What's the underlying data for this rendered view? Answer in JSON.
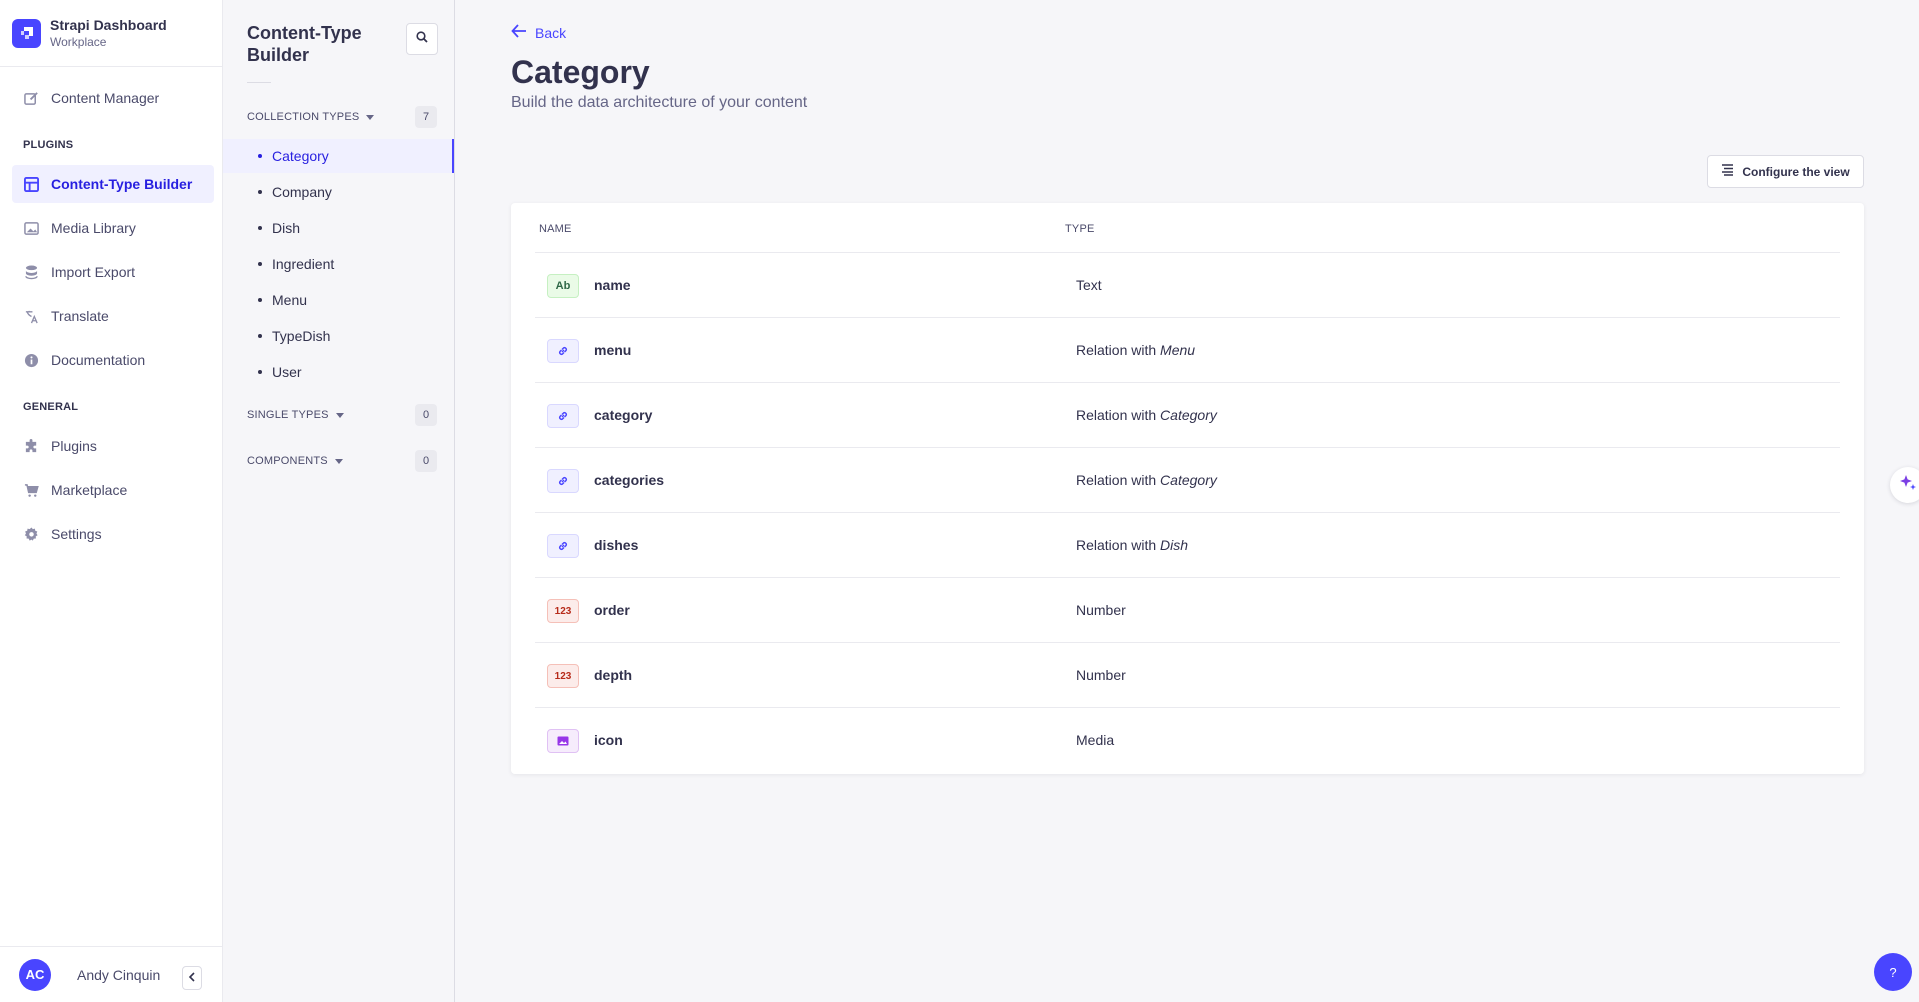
{
  "brand": {
    "title": "Strapi Dashboard",
    "subtitle": "Workplace"
  },
  "mainnav": {
    "content_manager": "Content Manager",
    "plugins_section": "PLUGINS",
    "plugins_items": [
      "Content-Type Builder",
      "Media Library",
      "Import Export",
      "Translate",
      "Documentation"
    ],
    "general_section": "GENERAL",
    "general_items": [
      "Plugins",
      "Marketplace",
      "Settings"
    ]
  },
  "user": {
    "initials": "AC",
    "name": "Andy Cinquin"
  },
  "subnav": {
    "title": "Content-Type Builder",
    "collection_types": {
      "label": "COLLECTION TYPES",
      "count": "7",
      "items": [
        "Category",
        "Company",
        "Dish",
        "Ingredient",
        "Menu",
        "TypeDish",
        "User"
      ]
    },
    "single_types": {
      "label": "SINGLE TYPES",
      "count": "0"
    },
    "components": {
      "label": "COMPONENTS",
      "count": "0"
    }
  },
  "page": {
    "back": "Back",
    "title": "Category",
    "subtitle": "Build the data architecture of your content",
    "configure": "Configure the view"
  },
  "table": {
    "headers": {
      "name": "NAME",
      "type": "TYPE"
    },
    "rows": [
      {
        "badge": "Ab",
        "name": "name",
        "type": "Text",
        "target": ""
      },
      {
        "badge": "",
        "name": "menu",
        "type": "Relation with",
        "target": "Menu"
      },
      {
        "badge": "",
        "name": "category",
        "type": "Relation with",
        "target": "Category"
      },
      {
        "badge": "",
        "name": "categories",
        "type": "Relation with",
        "target": "Category"
      },
      {
        "badge": "",
        "name": "dishes",
        "type": "Relation with",
        "target": "Dish"
      },
      {
        "badge": "123",
        "name": "order",
        "type": "Number",
        "target": ""
      },
      {
        "badge": "123",
        "name": "depth",
        "type": "Number",
        "target": ""
      },
      {
        "badge": "",
        "name": "icon",
        "type": "Media",
        "target": ""
      }
    ]
  },
  "help": "?",
  "colors": {
    "primary": "#4945ff",
    "active_bg": "#f0f0ff",
    "text": "#32324d"
  }
}
